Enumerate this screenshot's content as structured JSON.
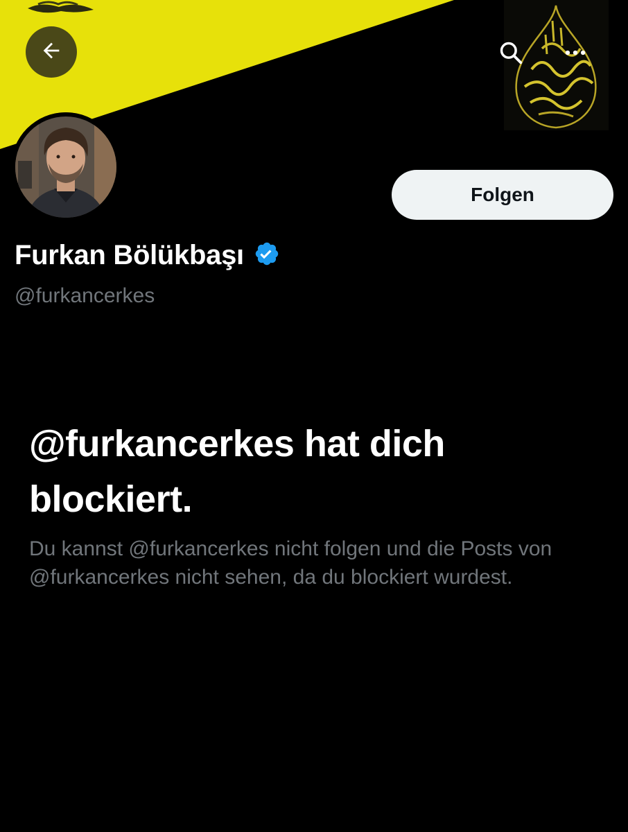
{
  "profile": {
    "name": "Furkan Bölükbaşı",
    "handle": "@furkancerkes",
    "verified": true,
    "verified_badge_color": "#1d9bf0"
  },
  "header": {
    "back_icon": "arrow-left-icon",
    "search_icon": "search-icon",
    "more_icon": "more-horizontal-icon",
    "banner_color": "#e7e10a"
  },
  "actions": {
    "follow_label": "Folgen"
  },
  "blocked": {
    "title": "@furkancerkes hat dich blockiert.",
    "description": "Du kannst @furkancerkes nicht folgen und die Posts von @furkancerkes nicht sehen, da du blockiert wurdest."
  }
}
